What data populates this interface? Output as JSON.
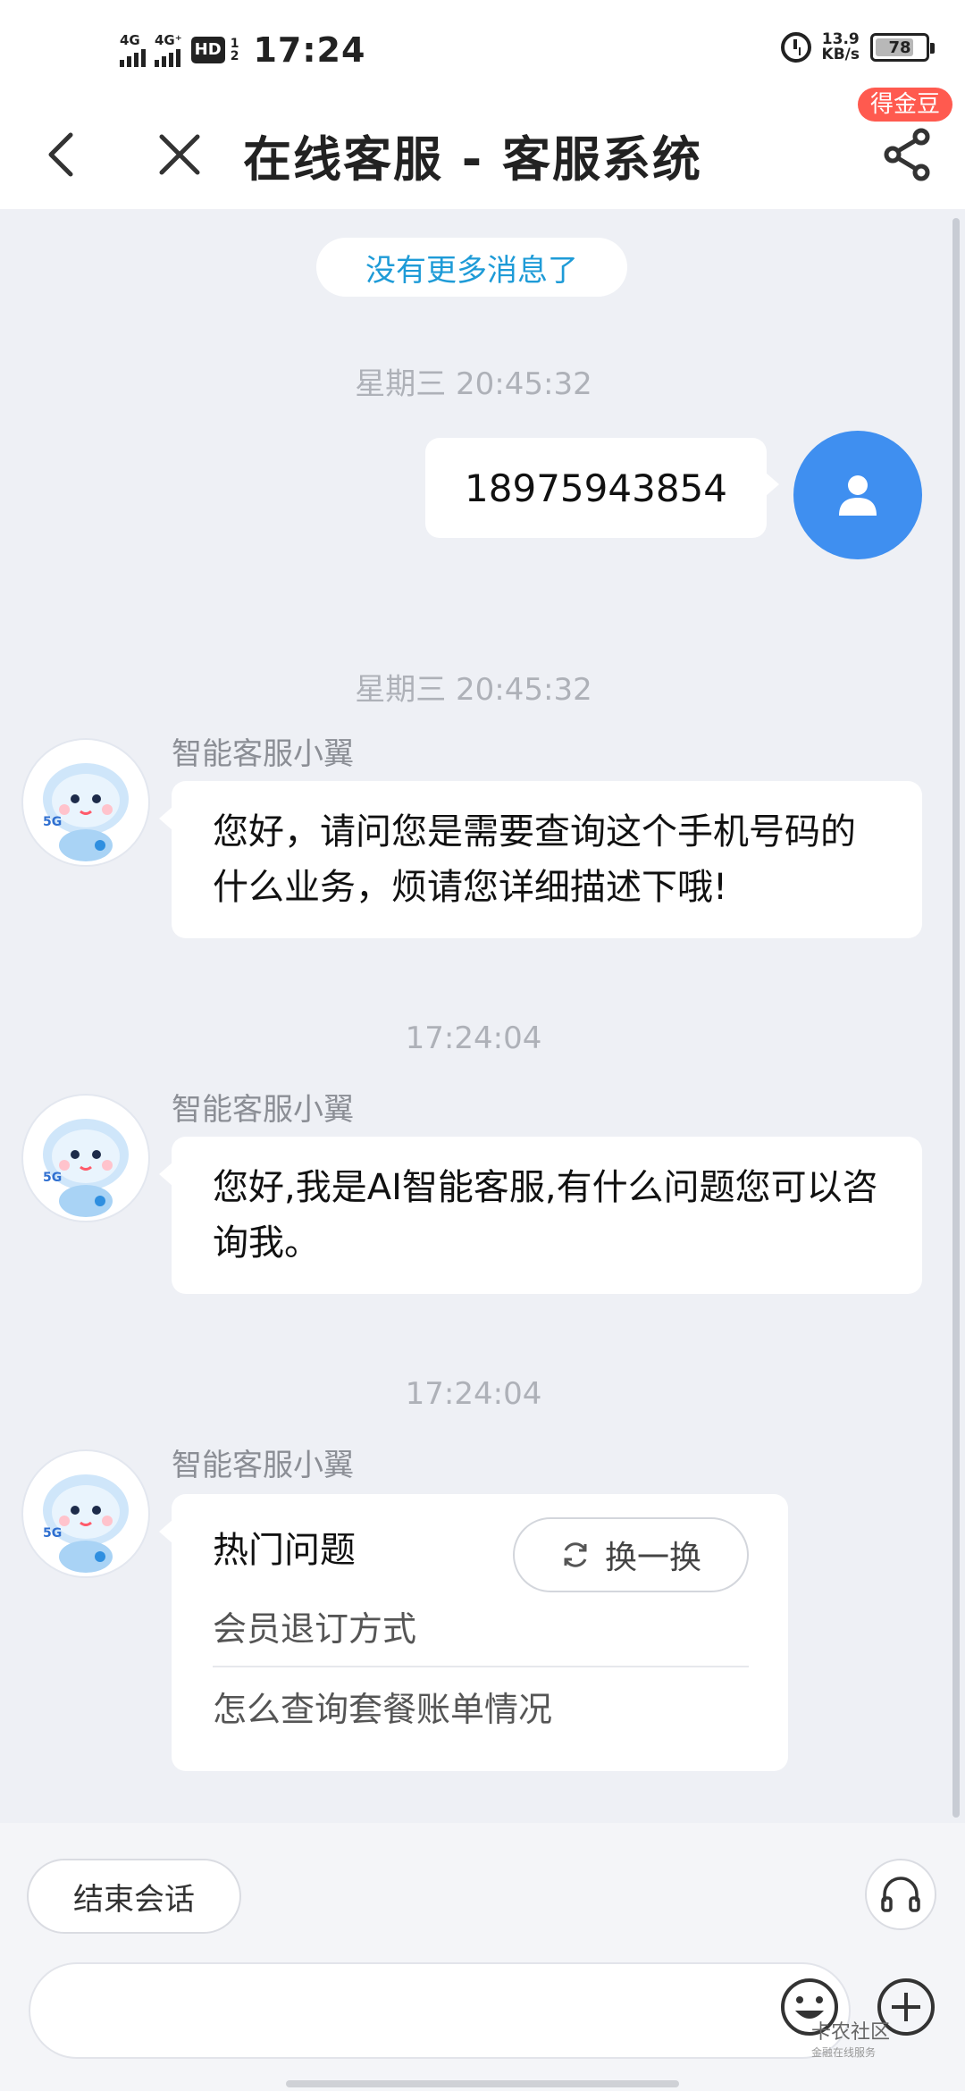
{
  "status_bar": {
    "signal1": "4G",
    "signal2": "4G⁺",
    "hd": "HD",
    "hd_sim": [
      "1",
      "2"
    ],
    "time": "17:24",
    "net_speed": [
      "13.9",
      "KB/s"
    ],
    "battery": "78",
    "battery_level": 0.78
  },
  "header": {
    "title": "在线客服 - 客服系统",
    "badge": "得金豆"
  },
  "chat": {
    "no_more": "没有更多消息了",
    "messages": [
      {
        "timestamp": "星期三 20:45:32",
        "text": "18975943854"
      },
      {
        "timestamp": "星期三 20:45:32",
        "sender": "智能客服小翼",
        "text": "您好，请问您是需要查询这个手机号码的什么业务，烦请您详细描述下哦!"
      },
      {
        "timestamp": "17:24:04",
        "sender": "智能客服小翼",
        "text": "您好,我是AI智能客服,有什么问题您可以咨询我。"
      },
      {
        "timestamp": "17:24:04",
        "sender": "智能客服小翼"
      }
    ],
    "hot_card": {
      "title": "热门问题",
      "swap_label": "换一换",
      "items": [
        "会员退订方式",
        "怎么查询套餐账单情况"
      ]
    },
    "bot_avatar_text": "5G"
  },
  "bottom_bar": {
    "end_session": "结束会话",
    "input_value": "",
    "watermark": [
      "卡农社区",
      "金融在线服务"
    ]
  }
}
